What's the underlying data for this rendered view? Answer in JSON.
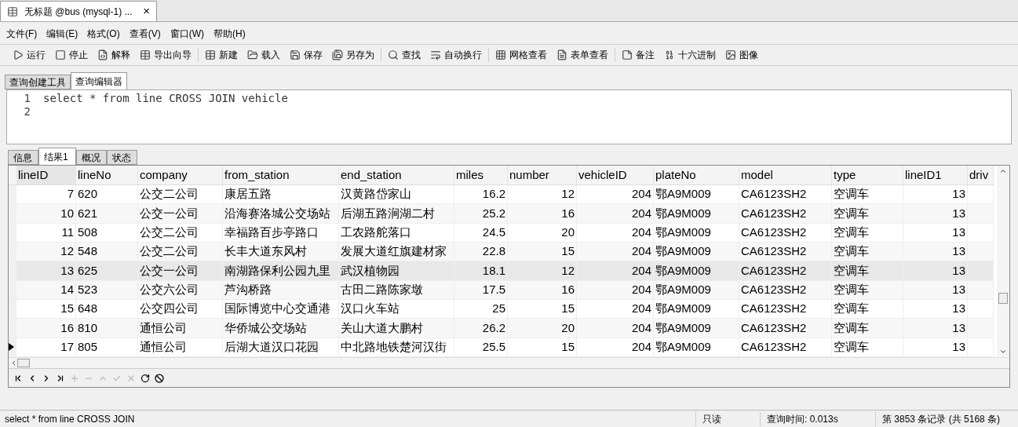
{
  "window": {
    "title": "无标题 @bus (mysql-1) ...",
    "close": "×"
  },
  "menu": [
    "文件(F)",
    "编辑(E)",
    "格式(O)",
    "查看(V)",
    "窗口(W)",
    "帮助(H)"
  ],
  "toolbar": [
    [
      {
        "label": "运行"
      },
      {
        "label": "停止"
      },
      {
        "label": "解释"
      },
      {
        "label": "导出向导"
      }
    ],
    [
      {
        "label": "新建"
      },
      {
        "label": "载入"
      },
      {
        "label": "保存"
      },
      {
        "label": "另存为"
      }
    ],
    [
      {
        "label": "查找"
      },
      {
        "label": "自动换行"
      }
    ],
    [
      {
        "label": "网格查看"
      },
      {
        "label": "表单查看"
      }
    ],
    [
      {
        "label": "备注"
      },
      {
        "label": "十六进制"
      },
      {
        "label": "图像"
      }
    ]
  ],
  "editor_tabs": [
    {
      "label": "查询创建工具",
      "selected": false
    },
    {
      "label": "查询编辑器",
      "selected": true
    }
  ],
  "editor": {
    "lines": [
      {
        "number": "1",
        "text": "select * from line CROSS JOIN vehicle"
      },
      {
        "number": "2"
      }
    ]
  },
  "result_tabs": [
    {
      "label": "信息",
      "selected": false
    },
    {
      "label": "结果1",
      "selected": true
    },
    {
      "label": "概况",
      "selected": false
    },
    {
      "label": "状态",
      "selected": false
    }
  ],
  "table": {
    "columns": [
      "lineID",
      "lineNo",
      "company",
      "from_station",
      "end_station",
      "miles",
      "number",
      "vehicleID",
      "plateNo",
      "model",
      "type",
      "lineID1",
      "driv"
    ],
    "rows": [
      {
        "selected": false,
        "current": false,
        "cells": [
          "7",
          "620",
          "公交二公司",
          "康居五路",
          "汉黄路岱家山",
          "16.2",
          "12",
          "204",
          "鄂A9M009",
          "CA6123SH2",
          "空调车",
          "13",
          null
        ]
      },
      {
        "selected": false,
        "current": false,
        "cells": [
          "10",
          "621",
          "公交一公司",
          "沿海赛洛城公交场站",
          "后湖五路涧湖二村",
          "25.2",
          "16",
          "204",
          "鄂A9M009",
          "CA6123SH2",
          "空调车",
          "13",
          null
        ]
      },
      {
        "selected": false,
        "current": false,
        "cells": [
          "11",
          "508",
          "公交二公司",
          "幸福路百步亭路口",
          "工农路舵落口",
          "24.5",
          "20",
          "204",
          "鄂A9M009",
          "CA6123SH2",
          "空调车",
          "13",
          null
        ]
      },
      {
        "selected": false,
        "current": false,
        "cells": [
          "12",
          "548",
          "公交二公司",
          "长丰大道东风村",
          "发展大道红旗建材家",
          "22.8",
          "15",
          "204",
          "鄂A9M009",
          "CA6123SH2",
          "空调车",
          "13",
          null
        ]
      },
      {
        "selected": true,
        "current": false,
        "cells": [
          "13",
          "625",
          "公交一公司",
          "南湖路保利公园九里",
          "武汉植物园",
          "18.1",
          "12",
          "204",
          "鄂A9M009",
          "CA6123SH2",
          "空调车",
          "13",
          null
        ]
      },
      {
        "selected": false,
        "current": false,
        "cells": [
          "14",
          "523",
          "公交六公司",
          "芦沟桥路",
          "古田二路陈家墩",
          "17.5",
          "16",
          "204",
          "鄂A9M009",
          "CA6123SH2",
          "空调车",
          "13",
          null
        ]
      },
      {
        "selected": false,
        "current": false,
        "cells": [
          "15",
          "648",
          "公交四公司",
          "国际博览中心交通港",
          "汉口火车站",
          "25",
          "15",
          "204",
          "鄂A9M009",
          "CA6123SH2",
          "空调车",
          "13",
          null
        ]
      },
      {
        "selected": false,
        "current": false,
        "cells": [
          "16",
          "810",
          "通恒公司",
          "华侨城公交场站",
          "关山大道大鹏村",
          "26.2",
          "20",
          "204",
          "鄂A9M009",
          "CA6123SH2",
          "空调车",
          "13",
          null
        ]
      },
      {
        "selected": false,
        "current": true,
        "cells": [
          "17",
          "805",
          "通恒公司",
          "后湖大道汉口花园",
          "中北路地铁楚河汉街",
          "25.5",
          "15",
          "204",
          "鄂A9M009",
          "CA6123SH2",
          "空调车",
          "13",
          null
        ]
      }
    ]
  },
  "nav_buttons": [
    {
      "disabled": false
    },
    {
      "disabled": false
    },
    {
      "disabled": false
    },
    {
      "disabled": false
    },
    {
      "disabled": true
    },
    {
      "disabled": true
    },
    {
      "disabled": true
    },
    {
      "disabled": true
    },
    {
      "disabled": true
    },
    {
      "disabled": false
    },
    {
      "disabled": false
    }
  ],
  "status_bar": {
    "query": "select * from line CROSS JOIN",
    "mode": "只读",
    "time": "查询时间: 0.013s",
    "records": "第 3853 条记录 (共 5168 条)"
  }
}
